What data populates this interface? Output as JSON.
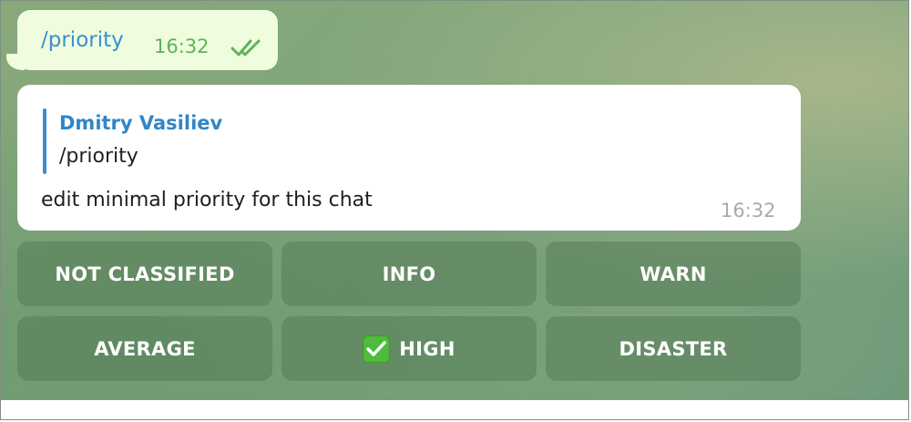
{
  "outgoing": {
    "text": "/priority",
    "time": "16:32",
    "status_icon": "double-check-icon",
    "status_color": "#5db35a"
  },
  "incoming": {
    "reply_author": "Dmitry Vasiliev",
    "reply_text": "/priority",
    "text": "edit minimal priority for this chat",
    "time": "16:32"
  },
  "keyboard": {
    "buttons": [
      {
        "label": "NOT CLASSIFIED"
      },
      {
        "label": "INFO"
      },
      {
        "label": "WARN"
      },
      {
        "label": "AVERAGE"
      },
      {
        "label": "HIGH",
        "icon": "check-mark-button-icon",
        "selected": true
      },
      {
        "label": "DISASTER"
      }
    ]
  },
  "colors": {
    "link_blue": "#3a8fd0",
    "check_green": "#4dbb3b"
  }
}
